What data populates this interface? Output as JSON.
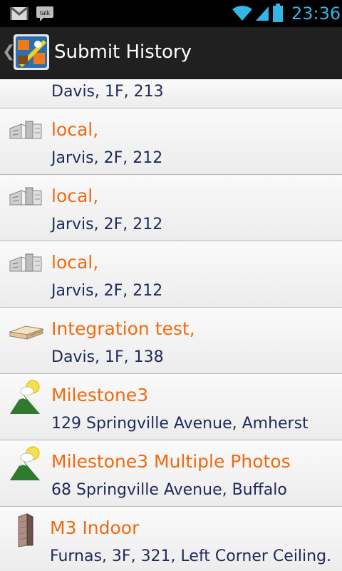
{
  "status_bar": {
    "time": "23:36",
    "icons": [
      "gmail-icon",
      "talk-icon",
      "wifi-icon",
      "signal-icon",
      "battery-icon"
    ],
    "talk_label": "talk"
  },
  "action_bar": {
    "title": "Submit History",
    "back_icon": "chevron-left-icon"
  },
  "history": {
    "items": [
      {
        "title": "",
        "location": "Davis, 1F, 213",
        "icon": "building-icon"
      },
      {
        "title": "local,",
        "location": "Jarvis, 2F, 212",
        "icon": "building-icon"
      },
      {
        "title": "local,",
        "location": "Jarvis, 2F, 212",
        "icon": "building-icon"
      },
      {
        "title": "local,",
        "location": "Jarvis, 2F, 212",
        "icon": "building-icon"
      },
      {
        "title": "Integration test,",
        "location": "Davis, 1F, 138",
        "icon": "low-building-icon"
      },
      {
        "title": "Milestone3",
        "location": "129 Springville Avenue, Amherst",
        "icon": "outdoor-hill-sun-icon"
      },
      {
        "title": "Milestone3 Multiple Photos",
        "location": "68 Springville Avenue, Buffalo",
        "icon": "outdoor-hill-sun-icon"
      },
      {
        "title": "M3 Indoor",
        "location": "Furnas, 3F, 321, Left Corner Ceiling.",
        "icon": "tower-building-icon"
      }
    ]
  },
  "colors": {
    "title_orange": "#f06a10",
    "location_navy": "#1d2a5a",
    "status_time": "#33b5e5"
  }
}
